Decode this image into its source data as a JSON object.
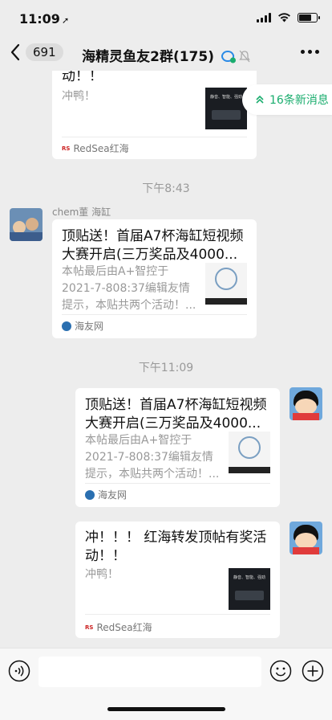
{
  "status": {
    "time": "11:09"
  },
  "nav": {
    "unread_count": "691",
    "group_title": "海精灵鱼友2群(175)"
  },
  "new_messages": {
    "label": "16条新消息"
  },
  "timestamps": [
    "下午8:43",
    "下午11:09"
  ],
  "messages": [
    {
      "title_tail": "动！！",
      "desc": "冲鸭！",
      "thumb_text": "静音、智能、强劲",
      "source": "RedSea红海"
    },
    {
      "sender": "chem董 海缸",
      "title": "顶贴送！首届A7杯海缸短视频大赛开启(三万奖品及4000...",
      "desc": "本帖最后由A+智控于2021-7-808:37编辑友情提示，本贴共两个活动！...",
      "source": "海友网"
    },
    {
      "title": "顶贴送！首届A7杯海缸短视频大赛开启(三万奖品及4000...",
      "desc": "本帖最后由A+智控于2021-7-808:37编辑友情提示，本贴共两个活动！...",
      "source": "海友网"
    },
    {
      "title": "冲！！！ 红海转发顶帖有奖活动！！",
      "desc": "冲鸭！",
      "thumb_text": "静音、智能、强劲",
      "source": "RedSea红海"
    }
  ],
  "colors": {
    "accent": "#1aad6e",
    "background": "#ededed"
  }
}
